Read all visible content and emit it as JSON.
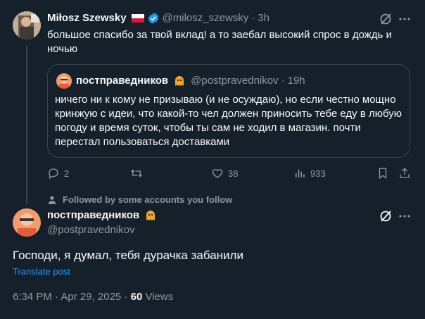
{
  "parent_tweet": {
    "author_name": "Miłosz Szewsky",
    "handle": "@milosz_szewsky",
    "separator": "·",
    "time": "3h",
    "text_line1": "большое спасибо за твой вклад! а то заебал высокий спрос в дождь и",
    "text_line2": "ночью",
    "quoted": {
      "author_name": "постправедников",
      "handle": "@postpravednikov",
      "separator": "·",
      "time": "19h",
      "lines": [
        "ничего ни к кому не призываю (и не осуждаю), но если честно мощно",
        "кринжую с идеи, что какой-то чел должен приносить тебе еду в любую",
        "погоду и время суток, чтобы ты сам не ходил в магазин. почти",
        "перестал пользоваться доставками"
      ]
    },
    "actions": {
      "replies": "2",
      "retweets": "",
      "likes": "38",
      "views": "933"
    }
  },
  "social_context": "Followed by some accounts you follow",
  "main_tweet": {
    "author_name": "постправедников",
    "handle": "@postpravednikov",
    "text": "Господи, я думал, тебя дурачка забанили",
    "translate_label": "Translate post",
    "timestamp": "6:34 PM · Apr 29, 2025 ·",
    "views_count": "60",
    "views_label": "Views"
  },
  "colors": {
    "background": "#15202b",
    "text": "#f7f9f9",
    "muted": "#8b98a5",
    "link": "#1d9bf0",
    "border": "#38444d",
    "verified": "#1d9bf0"
  },
  "icons": [
    "grok-icon",
    "more-icon",
    "verified-badge-icon",
    "poland-flag-icon",
    "reply-icon",
    "retweet-icon",
    "like-icon",
    "views-icon",
    "bookmark-icon",
    "share-icon",
    "person-icon",
    "ghost-emoji-icon"
  ]
}
